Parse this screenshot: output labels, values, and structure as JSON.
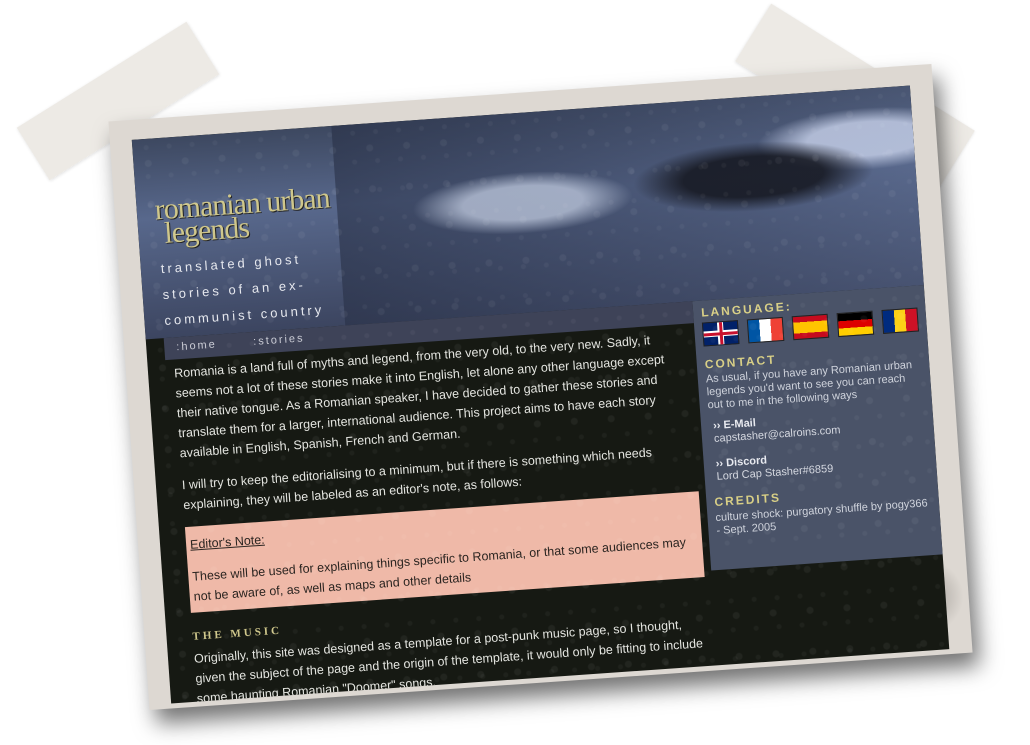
{
  "header": {
    "title_line1": "romanian urban",
    "title_line2": "legends",
    "tagline": "translated ghost stories of an ex-communist country"
  },
  "nav": {
    "items": [
      {
        "label": ":home"
      },
      {
        "label": ":stories"
      }
    ]
  },
  "main": {
    "intro": "Romania is a land full of myths and legend, from the very old, to the very new. Sadly, it seems not a lot of these stories make it into English, let alone any other language except their native tongue. As a Romanian speaker, I have decided to gather these stories and translate them for a larger, international audience. This project aims to have each story available in English, Spanish, French and German.",
    "editorial": "I will try to keep the editorialising to a minimum, but if there is something which needs explaining, they will be labeled as an editor's note, as follows:",
    "editor_note": {
      "label": "Editor's Note:",
      "text": "These will be used for explaining things specific to Romania, or that some audiences may not be aware of, as well as maps and other details"
    },
    "music_heading": "THE MUSIC",
    "music_text": "Originally, this site was designed as a template for a post-punk music page, so I thought, given the subject of the page and the origin of the template, it would only be fitting to include some haunting Romanian \"Doomer\" songs."
  },
  "sidebar": {
    "language_heading": "LANGUAGE:",
    "flags": [
      {
        "icon": "uk-flag-icon",
        "lang": "English"
      },
      {
        "icon": "france-flag-icon",
        "lang": "French"
      },
      {
        "icon": "spain-flag-icon",
        "lang": "Spanish"
      },
      {
        "icon": "germany-flag-icon",
        "lang": "German"
      },
      {
        "icon": "romania-flag-icon",
        "lang": "Romanian"
      }
    ],
    "contact_heading": "CONTACT",
    "contact_text": "As usual, if you have any Romanian urban legends you'd want to see you can reach out to me in the following ways",
    "email_label": "›› E-Mail",
    "email_value": "capstasher@calroins.com",
    "discord_label": "›› Discord",
    "discord_value": "Lord Cap Stasher#6859",
    "credits_heading": "CREDITS",
    "credits_text": "culture shock: purgatory shuffle by pogy366 - Sept. 2005"
  },
  "colors": {
    "title": "#cfc78b",
    "content_bg": "#161913",
    "sidebar_bg": "#4a5368",
    "editor_note_bg": "#efb9a8",
    "frame": "#ddd8d2"
  }
}
